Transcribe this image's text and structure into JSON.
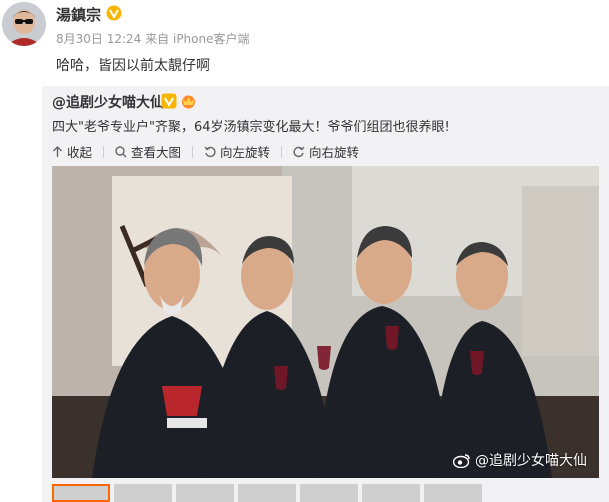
{
  "post": {
    "username": "湯鎮宗",
    "date": "8月30日 12:24",
    "source_prefix": "来自",
    "source": "iPhone客户端",
    "text": "哈哈，皆因以前太靚仔啊"
  },
  "repost": {
    "username": "@追剧少女喵大仙",
    "text": "四大\"老爷专业户\"齐聚，64岁汤镇宗变化最大！爷爷们组团也很养眼!",
    "toolbar": {
      "collapse": "收起",
      "view_large": "查看大图",
      "rotate_left": "向左旋转",
      "rotate_right": "向右旋转"
    },
    "photo_watermark": "@追剧少女喵大仙"
  },
  "colors": {
    "verified_badge": "#f7b500",
    "link": "#eb7350",
    "meta": "#999999"
  },
  "icons": [
    "verified-icon",
    "collapse-icon",
    "zoom-icon",
    "rotate-left-icon",
    "rotate-right-icon",
    "weibo-logo-icon"
  ]
}
